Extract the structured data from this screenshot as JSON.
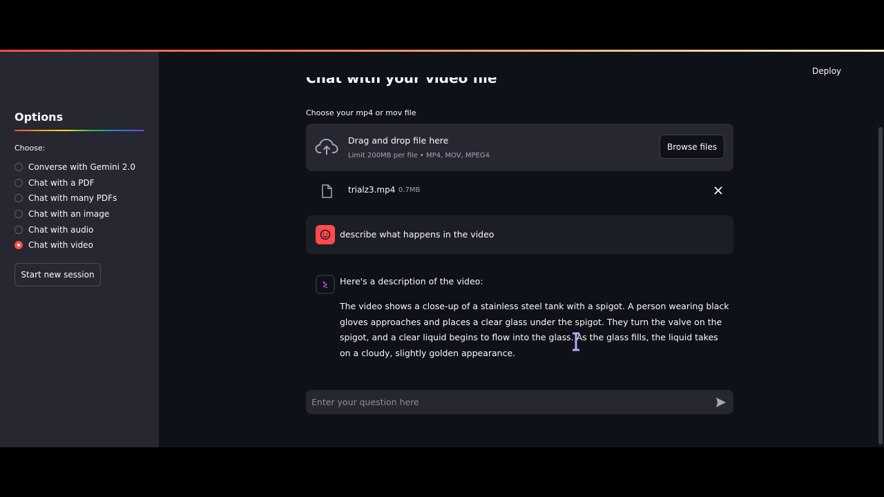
{
  "sidebar": {
    "title": "Options",
    "choose_label": "Choose:",
    "options": [
      {
        "label": "Converse with Gemini 2.0",
        "selected": false
      },
      {
        "label": "Chat with a PDF",
        "selected": false
      },
      {
        "label": "Chat with many PDFs",
        "selected": false
      },
      {
        "label": "Chat with an image",
        "selected": false
      },
      {
        "label": "Chat with audio",
        "selected": false
      },
      {
        "label": "Chat with video",
        "selected": true
      }
    ],
    "new_session_label": "Start new session"
  },
  "header": {
    "deploy_label": "Deploy"
  },
  "main": {
    "title": "Chat with your video file",
    "uploader": {
      "label": "Choose your mp4 or mov file",
      "drop_title": "Drag and drop file here",
      "limit": "Limit 200MB per file • MP4, MOV, MPEG4",
      "browse_label": "Browse files"
    },
    "file": {
      "name": "trialz3.mp4",
      "size": "0.7MB"
    },
    "messages": {
      "user": "describe what happens in the video",
      "assistant_intro": "Here's a description of the video:",
      "assistant_body": "The video shows a close-up of a stainless steel tank with a spigot. A person wearing black gloves approaches and places a clear glass under the spigot. They turn the valve on the spigot, and a clear liquid begins to flow into the glass. As the glass fills, the liquid takes on a cloudy, slightly golden appearance."
    },
    "chat_input": {
      "placeholder": "Enter your question here",
      "value": ""
    }
  },
  "colors": {
    "accent": "#ff4b4b",
    "background": "#0e1117",
    "sidebar": "#262730"
  }
}
